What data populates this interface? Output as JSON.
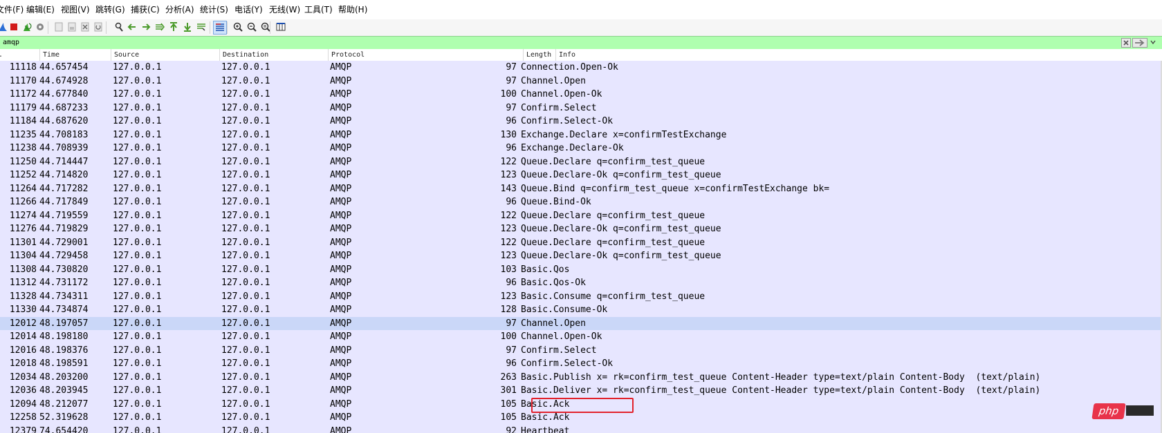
{
  "menu": [
    "文件(F)",
    "编辑(E)",
    "视图(V)",
    "跳转(G)",
    "捕获(C)",
    "分析(A)",
    "统计(S)",
    "电话(Y)",
    "无线(W)",
    "工具(T)",
    "帮助(H)"
  ],
  "toolbar": {
    "icons": [
      "shark-fin-icon",
      "stop-capture-icon",
      "restart-capture-icon",
      "capture-options-icon",
      "open-file-icon",
      "save-file-icon",
      "close-file-icon",
      "reload-file-icon",
      "find-packet-icon",
      "go-back-icon",
      "go-forward-icon",
      "go-to-packet-icon",
      "go-first-packet-icon",
      "go-last-packet-icon",
      "auto-scroll-icon",
      "colorize-icon",
      "zoom-in-icon",
      "zoom-out-icon",
      "normal-size-icon",
      "resize-columns-icon"
    ],
    "active": "colorize-icon"
  },
  "filter": {
    "value": "amqp",
    "background": "#afffaf"
  },
  "columns": [
    "No.",
    "Time",
    "Source",
    "Destination",
    "Protocol",
    "Length",
    "Info"
  ],
  "packets": [
    {
      "no": "11118",
      "time": "44.657454",
      "src": "127.0.0.1",
      "dst": "127.0.0.1",
      "proto": "AMQP",
      "len": "97",
      "info": "Connection.Open-Ok"
    },
    {
      "no": "11170",
      "time": "44.674928",
      "src": "127.0.0.1",
      "dst": "127.0.0.1",
      "proto": "AMQP",
      "len": "97",
      "info": "Channel.Open"
    },
    {
      "no": "11172",
      "time": "44.677840",
      "src": "127.0.0.1",
      "dst": "127.0.0.1",
      "proto": "AMQP",
      "len": "100",
      "info": "Channel.Open-Ok"
    },
    {
      "no": "11179",
      "time": "44.687233",
      "src": "127.0.0.1",
      "dst": "127.0.0.1",
      "proto": "AMQP",
      "len": "97",
      "info": "Confirm.Select"
    },
    {
      "no": "11184",
      "time": "44.687620",
      "src": "127.0.0.1",
      "dst": "127.0.0.1",
      "proto": "AMQP",
      "len": "96",
      "info": "Confirm.Select-Ok"
    },
    {
      "no": "11235",
      "time": "44.708183",
      "src": "127.0.0.1",
      "dst": "127.0.0.1",
      "proto": "AMQP",
      "len": "130",
      "info": "Exchange.Declare x=confirmTestExchange"
    },
    {
      "no": "11238",
      "time": "44.708939",
      "src": "127.0.0.1",
      "dst": "127.0.0.1",
      "proto": "AMQP",
      "len": "96",
      "info": "Exchange.Declare-Ok"
    },
    {
      "no": "11250",
      "time": "44.714447",
      "src": "127.0.0.1",
      "dst": "127.0.0.1",
      "proto": "AMQP",
      "len": "122",
      "info": "Queue.Declare q=confirm_test_queue"
    },
    {
      "no": "11252",
      "time": "44.714820",
      "src": "127.0.0.1",
      "dst": "127.0.0.1",
      "proto": "AMQP",
      "len": "123",
      "info": "Queue.Declare-Ok q=confirm_test_queue"
    },
    {
      "no": "11264",
      "time": "44.717282",
      "src": "127.0.0.1",
      "dst": "127.0.0.1",
      "proto": "AMQP",
      "len": "143",
      "info": "Queue.Bind q=confirm_test_queue x=confirmTestExchange bk="
    },
    {
      "no": "11266",
      "time": "44.717849",
      "src": "127.0.0.1",
      "dst": "127.0.0.1",
      "proto": "AMQP",
      "len": "96",
      "info": "Queue.Bind-Ok"
    },
    {
      "no": "11274",
      "time": "44.719559",
      "src": "127.0.0.1",
      "dst": "127.0.0.1",
      "proto": "AMQP",
      "len": "122",
      "info": "Queue.Declare q=confirm_test_queue"
    },
    {
      "no": "11276",
      "time": "44.719829",
      "src": "127.0.0.1",
      "dst": "127.0.0.1",
      "proto": "AMQP",
      "len": "123",
      "info": "Queue.Declare-Ok q=confirm_test_queue"
    },
    {
      "no": "11301",
      "time": "44.729001",
      "src": "127.0.0.1",
      "dst": "127.0.0.1",
      "proto": "AMQP",
      "len": "122",
      "info": "Queue.Declare q=confirm_test_queue"
    },
    {
      "no": "11304",
      "time": "44.729458",
      "src": "127.0.0.1",
      "dst": "127.0.0.1",
      "proto": "AMQP",
      "len": "123",
      "info": "Queue.Declare-Ok q=confirm_test_queue"
    },
    {
      "no": "11308",
      "time": "44.730820",
      "src": "127.0.0.1",
      "dst": "127.0.0.1",
      "proto": "AMQP",
      "len": "103",
      "info": "Basic.Qos"
    },
    {
      "no": "11312",
      "time": "44.731172",
      "src": "127.0.0.1",
      "dst": "127.0.0.1",
      "proto": "AMQP",
      "len": "96",
      "info": "Basic.Qos-Ok"
    },
    {
      "no": "11328",
      "time": "44.734311",
      "src": "127.0.0.1",
      "dst": "127.0.0.1",
      "proto": "AMQP",
      "len": "123",
      "info": "Basic.Consume q=confirm_test_queue"
    },
    {
      "no": "11330",
      "time": "44.734874",
      "src": "127.0.0.1",
      "dst": "127.0.0.1",
      "proto": "AMQP",
      "len": "128",
      "info": "Basic.Consume-Ok"
    },
    {
      "no": "12012",
      "time": "48.197057",
      "src": "127.0.0.1",
      "dst": "127.0.0.1",
      "proto": "AMQP",
      "len": "97",
      "info": "Channel.Open",
      "selected": true
    },
    {
      "no": "12014",
      "time": "48.198180",
      "src": "127.0.0.1",
      "dst": "127.0.0.1",
      "proto": "AMQP",
      "len": "100",
      "info": "Channel.Open-Ok"
    },
    {
      "no": "12016",
      "time": "48.198376",
      "src": "127.0.0.1",
      "dst": "127.0.0.1",
      "proto": "AMQP",
      "len": "97",
      "info": "Confirm.Select"
    },
    {
      "no": "12018",
      "time": "48.198591",
      "src": "127.0.0.1",
      "dst": "127.0.0.1",
      "proto": "AMQP",
      "len": "96",
      "info": "Confirm.Select-Ok"
    },
    {
      "no": "12034",
      "time": "48.203200",
      "src": "127.0.0.1",
      "dst": "127.0.0.1",
      "proto": "AMQP",
      "len": "263",
      "info": "Basic.Publish x= rk=confirm_test_queue Content-Header type=text/plain Content-Body  (text/plain)"
    },
    {
      "no": "12036",
      "time": "48.203945",
      "src": "127.0.0.1",
      "dst": "127.0.0.1",
      "proto": "AMQP",
      "len": "301",
      "info": "Basic.Deliver x= rk=confirm_test_queue Content-Header type=text/plain Content-Body  (text/plain)"
    },
    {
      "no": "12094",
      "time": "48.212077",
      "src": "127.0.0.1",
      "dst": "127.0.0.1",
      "proto": "AMQP",
      "len": "105",
      "info": "Basic.Ack",
      "highlighted": true
    },
    {
      "no": "12258",
      "time": "52.319628",
      "src": "127.0.0.1",
      "dst": "127.0.0.1",
      "proto": "AMQP",
      "len": "105",
      "info": "Basic.Ack"
    },
    {
      "no": "12379",
      "time": "74.654420",
      "src": "127.0.0.1",
      "dst": "127.0.0.1",
      "proto": "AMQP",
      "len": "92",
      "info": "Heartbeat"
    }
  ],
  "colors": {
    "row": "#e7e6ff",
    "selected_row": "#cad7f8",
    "highlight_box": "#e2212b"
  },
  "watermark": {
    "text": "php"
  }
}
